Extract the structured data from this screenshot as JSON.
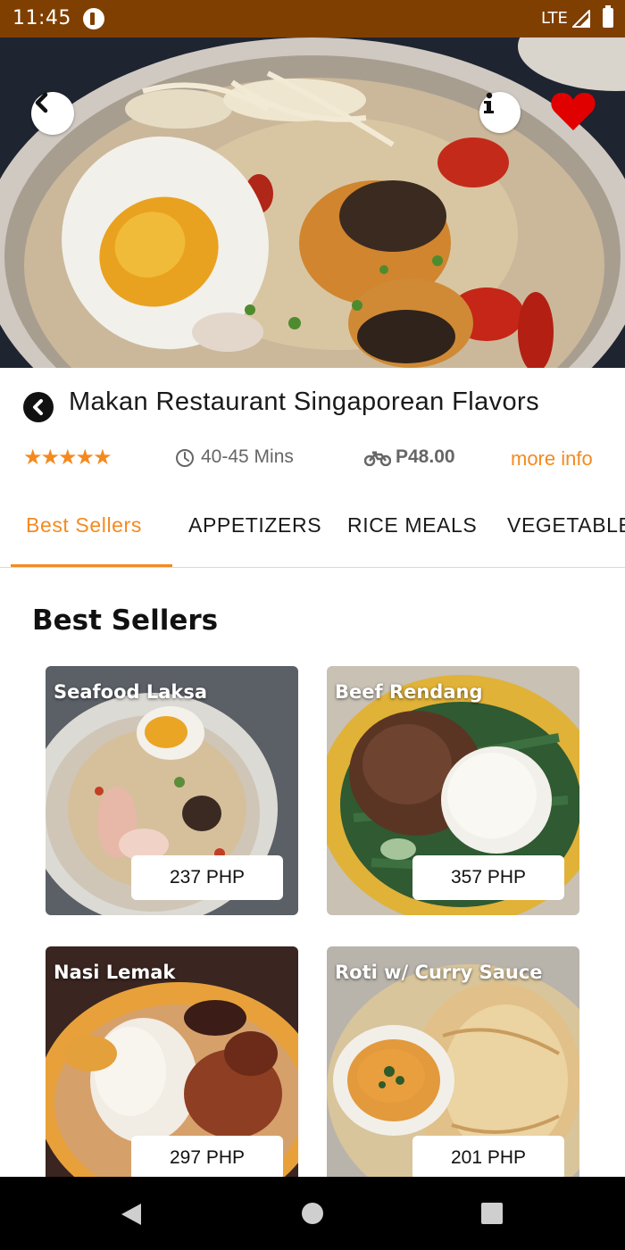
{
  "status_bar": {
    "time": "11:45",
    "network": "LTE"
  },
  "restaurant": {
    "name": "Makan Restaurant Singaporean Flavors",
    "rating_stars": "★★★★★",
    "rating": 5,
    "delivery_time": "40-45 Mins",
    "delivery_fee": "P48.00",
    "more_info": "more info"
  },
  "tabs": [
    {
      "label": "Best Sellers",
      "active": true
    },
    {
      "label": "APPETIZERS",
      "active": false
    },
    {
      "label": "RICE MEALS",
      "active": false
    },
    {
      "label": "VEGETABLES",
      "active": false
    }
  ],
  "section": {
    "title": "Best Sellers"
  },
  "items": [
    {
      "name": "Seafood Laksa",
      "price": "237 PHP"
    },
    {
      "name": "Beef Rendang",
      "price": "357 PHP"
    },
    {
      "name": "Nasi Lemak",
      "price": "297 PHP"
    },
    {
      "name": "Roti w/ Curry Sauce",
      "price": "201 PHP"
    }
  ],
  "colors": {
    "accent": "#f48a1f",
    "status_bar": "#7f3f00",
    "favorite": "#e00000"
  },
  "icons": [
    "back-icon",
    "info-icon",
    "heart-icon",
    "clock-icon",
    "motorcycle-icon"
  ]
}
